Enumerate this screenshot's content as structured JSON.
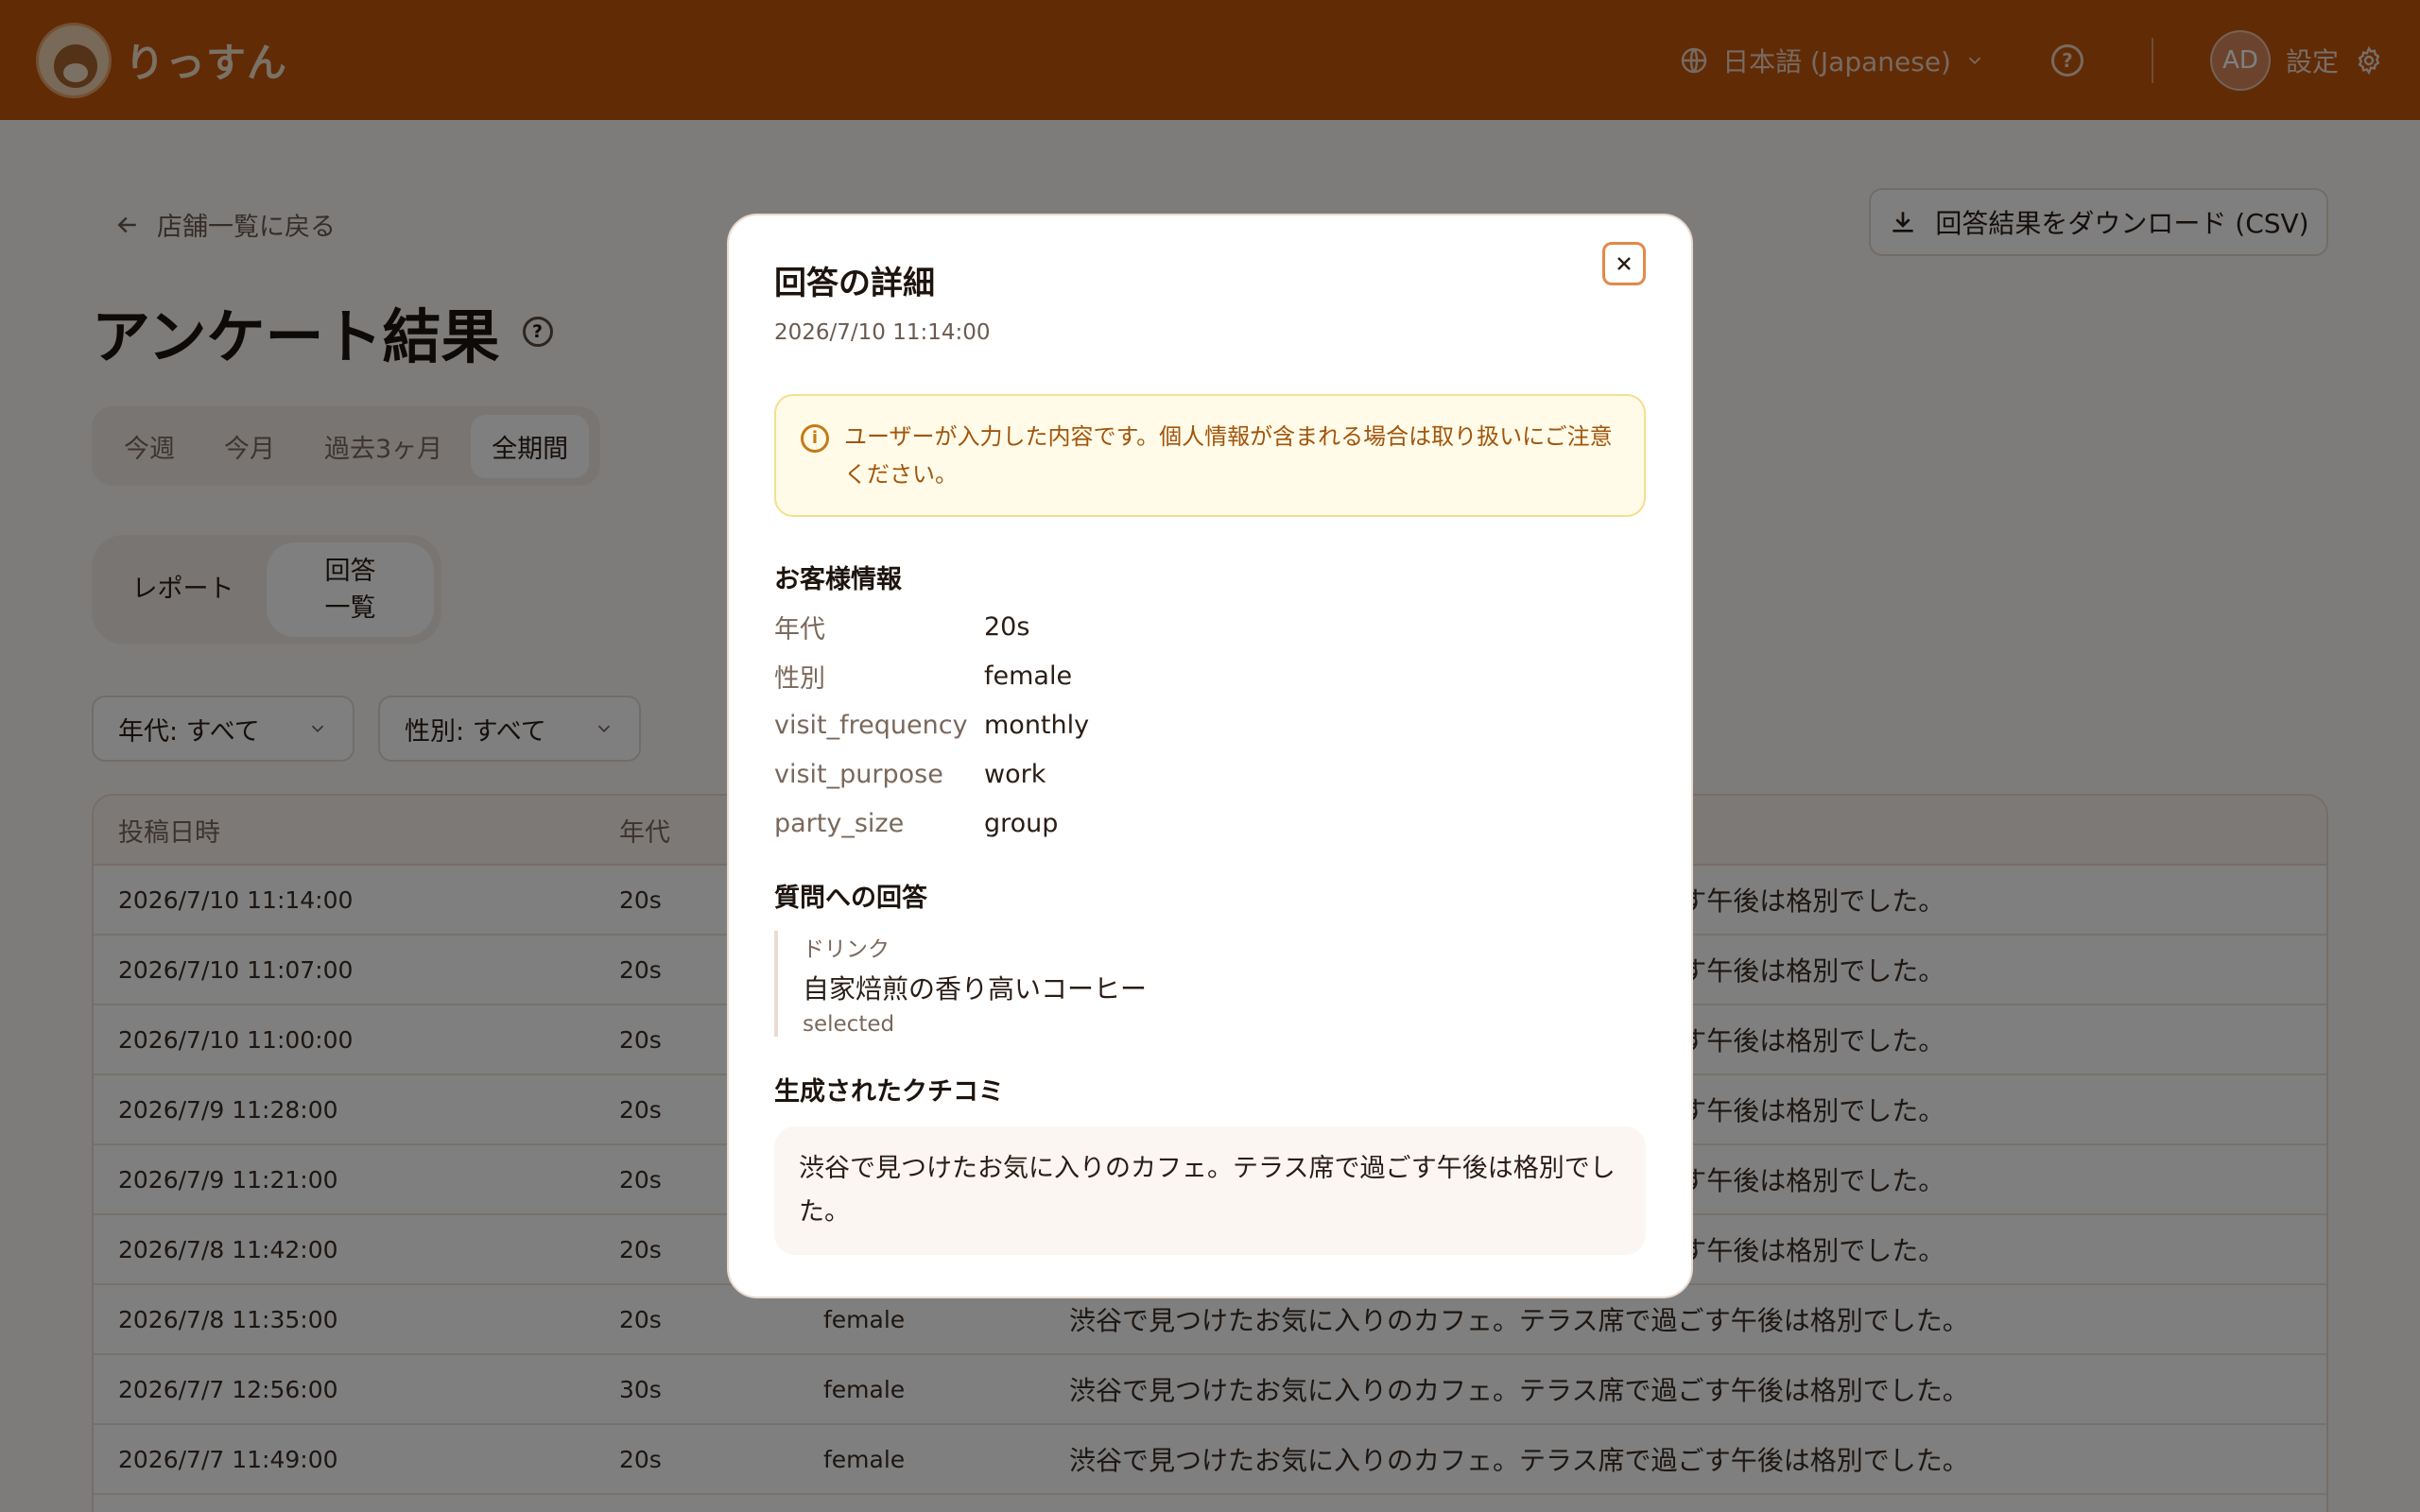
{
  "header": {
    "logo_text": "りっすん",
    "language": "日本語 (Japanese)",
    "avatar": "AD",
    "settings_label": "設定"
  },
  "page": {
    "back_label": "店舗一覧に戻る",
    "title": "アンケート結果",
    "download_label": "回答結果をダウンロード (CSV)",
    "period_tabs": [
      "今週",
      "今月",
      "過去3ヶ月",
      "全期間"
    ],
    "period_active": "全期間",
    "view_tabs": [
      "レポート",
      "回答一覧"
    ],
    "view_active": "回答一覧",
    "filters": {
      "age": "年代: すべて",
      "gender": "性別: すべて"
    }
  },
  "table": {
    "headers": [
      "投稿日時",
      "年代"
    ],
    "rows": [
      {
        "date": "2026/7/10 11:14:00",
        "age": "20s",
        "gender": "",
        "review": "ごす午後は格別でした。"
      },
      {
        "date": "2026/7/10 11:07:00",
        "age": "20s",
        "gender": "",
        "review": "ごす午後は格別でした。"
      },
      {
        "date": "2026/7/10 11:00:00",
        "age": "20s",
        "gender": "",
        "review": "ごす午後は格別でした。"
      },
      {
        "date": "2026/7/9 11:28:00",
        "age": "20s",
        "gender": "",
        "review": "ごす午後は格別でした。"
      },
      {
        "date": "2026/7/9 11:21:00",
        "age": "20s",
        "gender": "",
        "review": "ごす午後は格別でした。"
      },
      {
        "date": "2026/7/8 11:42:00",
        "age": "20s",
        "gender": "",
        "review": "ごす午後は格別でした。"
      },
      {
        "date": "2026/7/8 11:35:00",
        "age": "20s",
        "gender": "female",
        "review": "渋谷で見つけたお気に入りのカフェ。テラス席で過ごす午後は格別でした。"
      },
      {
        "date": "2026/7/7 12:56:00",
        "age": "30s",
        "gender": "female",
        "review": "渋谷で見つけたお気に入りのカフェ。テラス席で過ごす午後は格別でした。"
      },
      {
        "date": "2026/7/7 11:49:00",
        "age": "20s",
        "gender": "female",
        "review": "渋谷で見つけたお気に入りのカフェ。テラス席で過ごす午後は格別でした。"
      }
    ]
  },
  "modal": {
    "title": "回答の詳細",
    "date": "2026/7/10 11:14:00",
    "notice": "ユーザーが入力した内容です。個人情報が含まれる場合は取り扱いにご注意ください。",
    "customer_heading": "お客様情報",
    "customer_info": [
      {
        "label": "年代",
        "value": "20s"
      },
      {
        "label": "性別",
        "value": "female"
      },
      {
        "label": "visit_frequency",
        "value": "monthly"
      },
      {
        "label": "visit_purpose",
        "value": "work"
      },
      {
        "label": "party_size",
        "value": "group"
      }
    ],
    "answers_heading": "質問への回答",
    "answer": {
      "question": "ドリンク",
      "value": "自家焙煎の香り高いコーヒー",
      "type": "selected"
    },
    "review_heading": "生成されたクチコミ",
    "review": "渋谷で見つけたお気に入りのカフェ。テラス席で過ごす午後は格別でした。"
  },
  "colors": {
    "header_bg": "#c2570c",
    "accent": "#e08a4c",
    "notice_bg": "#fffbe8",
    "notice_text": "#a1550c"
  }
}
